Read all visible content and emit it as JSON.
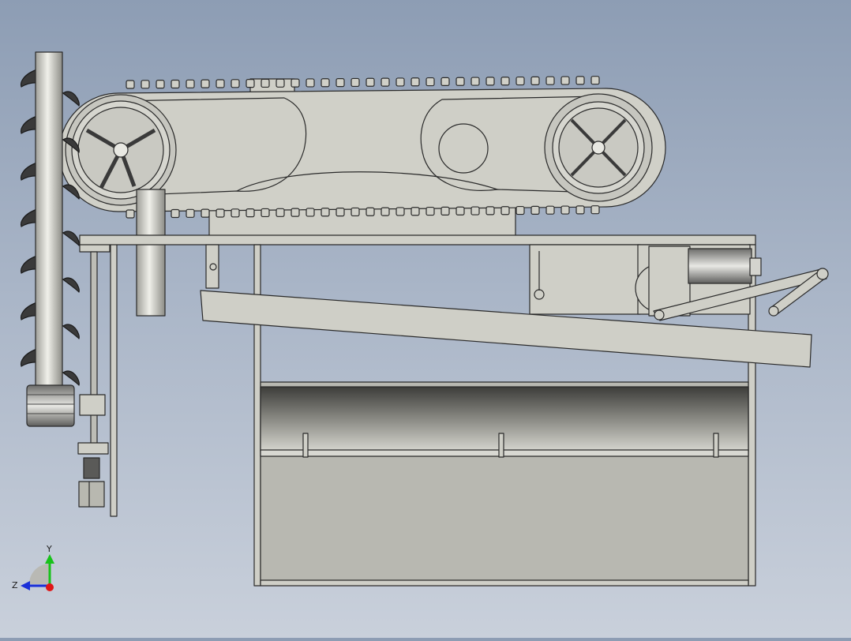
{
  "viewport": {
    "background_top": "#8d9db4",
    "background_bottom": "#c9d0db"
  },
  "triad": {
    "y_label": "Y",
    "z_label": "Z",
    "y_color": "#18c21a",
    "z_color": "#1a2fd8",
    "x_color": "#e01616"
  },
  "colors": {
    "part_fill": "#cfcfc7",
    "part_stroke": "#2a2a2a",
    "shaft_fill": "#c8c8c0",
    "auger_fill": "#3a3a3a",
    "motor_fill": "#9a9a96"
  }
}
